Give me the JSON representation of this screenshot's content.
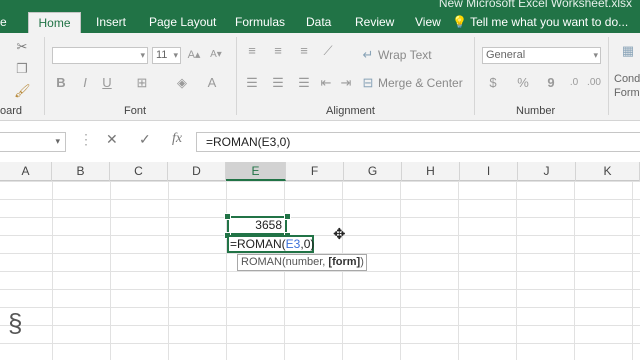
{
  "window": {
    "title": "New Microsoft Excel Worksheet.xlsx"
  },
  "tabs": [
    {
      "label": "Home"
    },
    {
      "label": "Insert"
    },
    {
      "label": "Page Layout"
    },
    {
      "label": "Formulas"
    },
    {
      "label": "Data"
    },
    {
      "label": "Review"
    },
    {
      "label": "View"
    }
  ],
  "tell_me": {
    "placeholder": "Tell me what you want to do..."
  },
  "ribbon": {
    "clipboard_label": "oard",
    "font_label": "Font",
    "font_size": "11",
    "font_bold": "B",
    "font_italic": "I",
    "font_underline": "U",
    "alignment_label": "Alignment",
    "wrap_text": "Wrap Text",
    "merge_center": "Merge & Center",
    "number_label": "Number",
    "number_format": "General",
    "currency": "$",
    "percent": "%",
    "comma": "9",
    "conditional_1": "Cond",
    "conditional_2": "Forma"
  },
  "formula_bar": {
    "cancel": "✕",
    "enter": "✓",
    "fx": "fx",
    "formula": "=ROMAN(E3,0)"
  },
  "columns": [
    "A",
    "B",
    "C",
    "D",
    "E",
    "F",
    "G",
    "H",
    "I",
    "J",
    "K"
  ],
  "selected_column": "E",
  "cells": {
    "E3_value": "3658",
    "edit_prefix": "=ROMAN(",
    "edit_ref": "E3",
    "edit_suffix": ",0)",
    "tooltip_fn": "ROMAN(number, ",
    "tooltip_arg": "[form]",
    "tooltip_close": ")"
  },
  "colors": {
    "accent": "#217346",
    "reference": "#3a6fd8"
  }
}
